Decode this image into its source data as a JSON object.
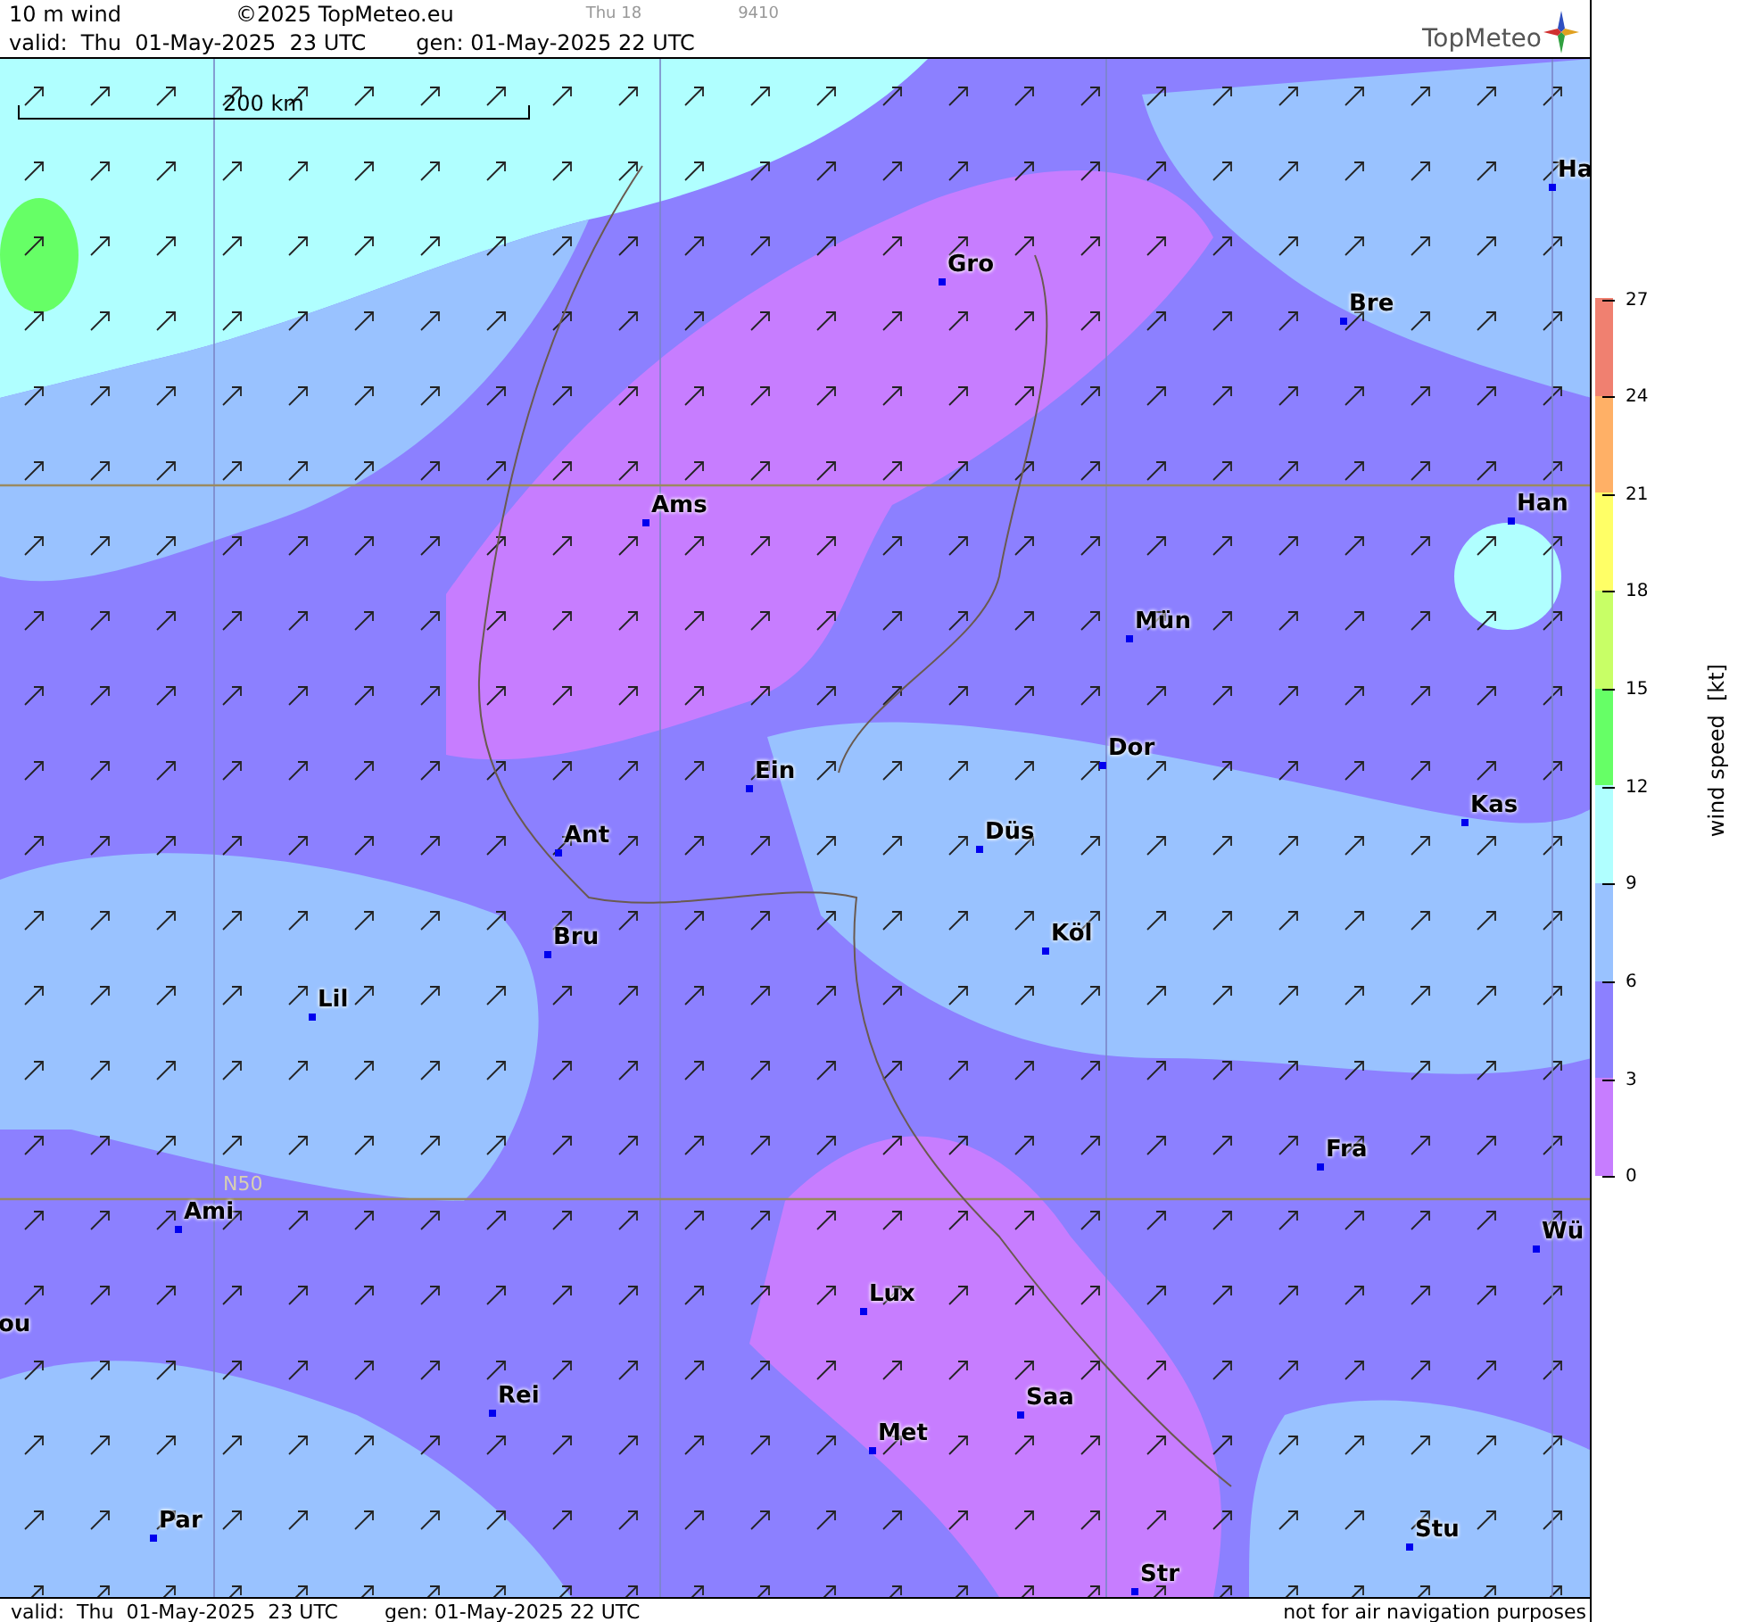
{
  "header": {
    "title": "10 m wind",
    "copyright": "©2025 TopMeteo.eu",
    "run_label": "Thu 18",
    "code": "9410",
    "valid": "valid:  Thu  01-May-2025  23 UTC",
    "generated": "gen: 01-May-2025 22 UTC",
    "logo": "TopMeteo"
  },
  "map": {
    "scale": "200 km",
    "latitude_label": "N50",
    "cities": [
      {
        "name": "Ha"
      },
      {
        "name": "Gro"
      },
      {
        "name": "Bre"
      },
      {
        "name": "Ams"
      },
      {
        "name": "Han"
      },
      {
        "name": "Mün"
      },
      {
        "name": "Ein"
      },
      {
        "name": "Dor"
      },
      {
        "name": "Kas"
      },
      {
        "name": "Ant"
      },
      {
        "name": "Düs"
      },
      {
        "name": "Köl"
      },
      {
        "name": "Bru"
      },
      {
        "name": "Lil"
      },
      {
        "name": "Fra"
      },
      {
        "name": "Ami"
      },
      {
        "name": "Wü"
      },
      {
        "name": "Lux"
      },
      {
        "name": "ou"
      },
      {
        "name": "Rei"
      },
      {
        "name": "Saa"
      },
      {
        "name": "Met"
      },
      {
        "name": "Par"
      },
      {
        "name": "Stu"
      },
      {
        "name": "Str"
      }
    ]
  },
  "legend": {
    "title": "wind speed  [kt]",
    "ticks": [
      "27",
      "24",
      "21",
      "18",
      "15",
      "12",
      "9",
      "6",
      "3",
      "0"
    ],
    "bands": [
      {
        "color": "#f08070"
      },
      {
        "color": "#ffb066"
      },
      {
        "color": "#ffff66"
      },
      {
        "color": "#c8ff66"
      },
      {
        "color": "#66ff66"
      },
      {
        "color": "#b0ffff"
      },
      {
        "color": "#99c2ff"
      },
      {
        "color": "#8c80ff"
      },
      {
        "color": "#c77dff"
      }
    ]
  },
  "footer": {
    "valid": "valid:  Thu  01-May-2025  23 UTC",
    "generated": "gen: 01-May-2025 22 UTC",
    "note": "not for air navigation purposes"
  }
}
